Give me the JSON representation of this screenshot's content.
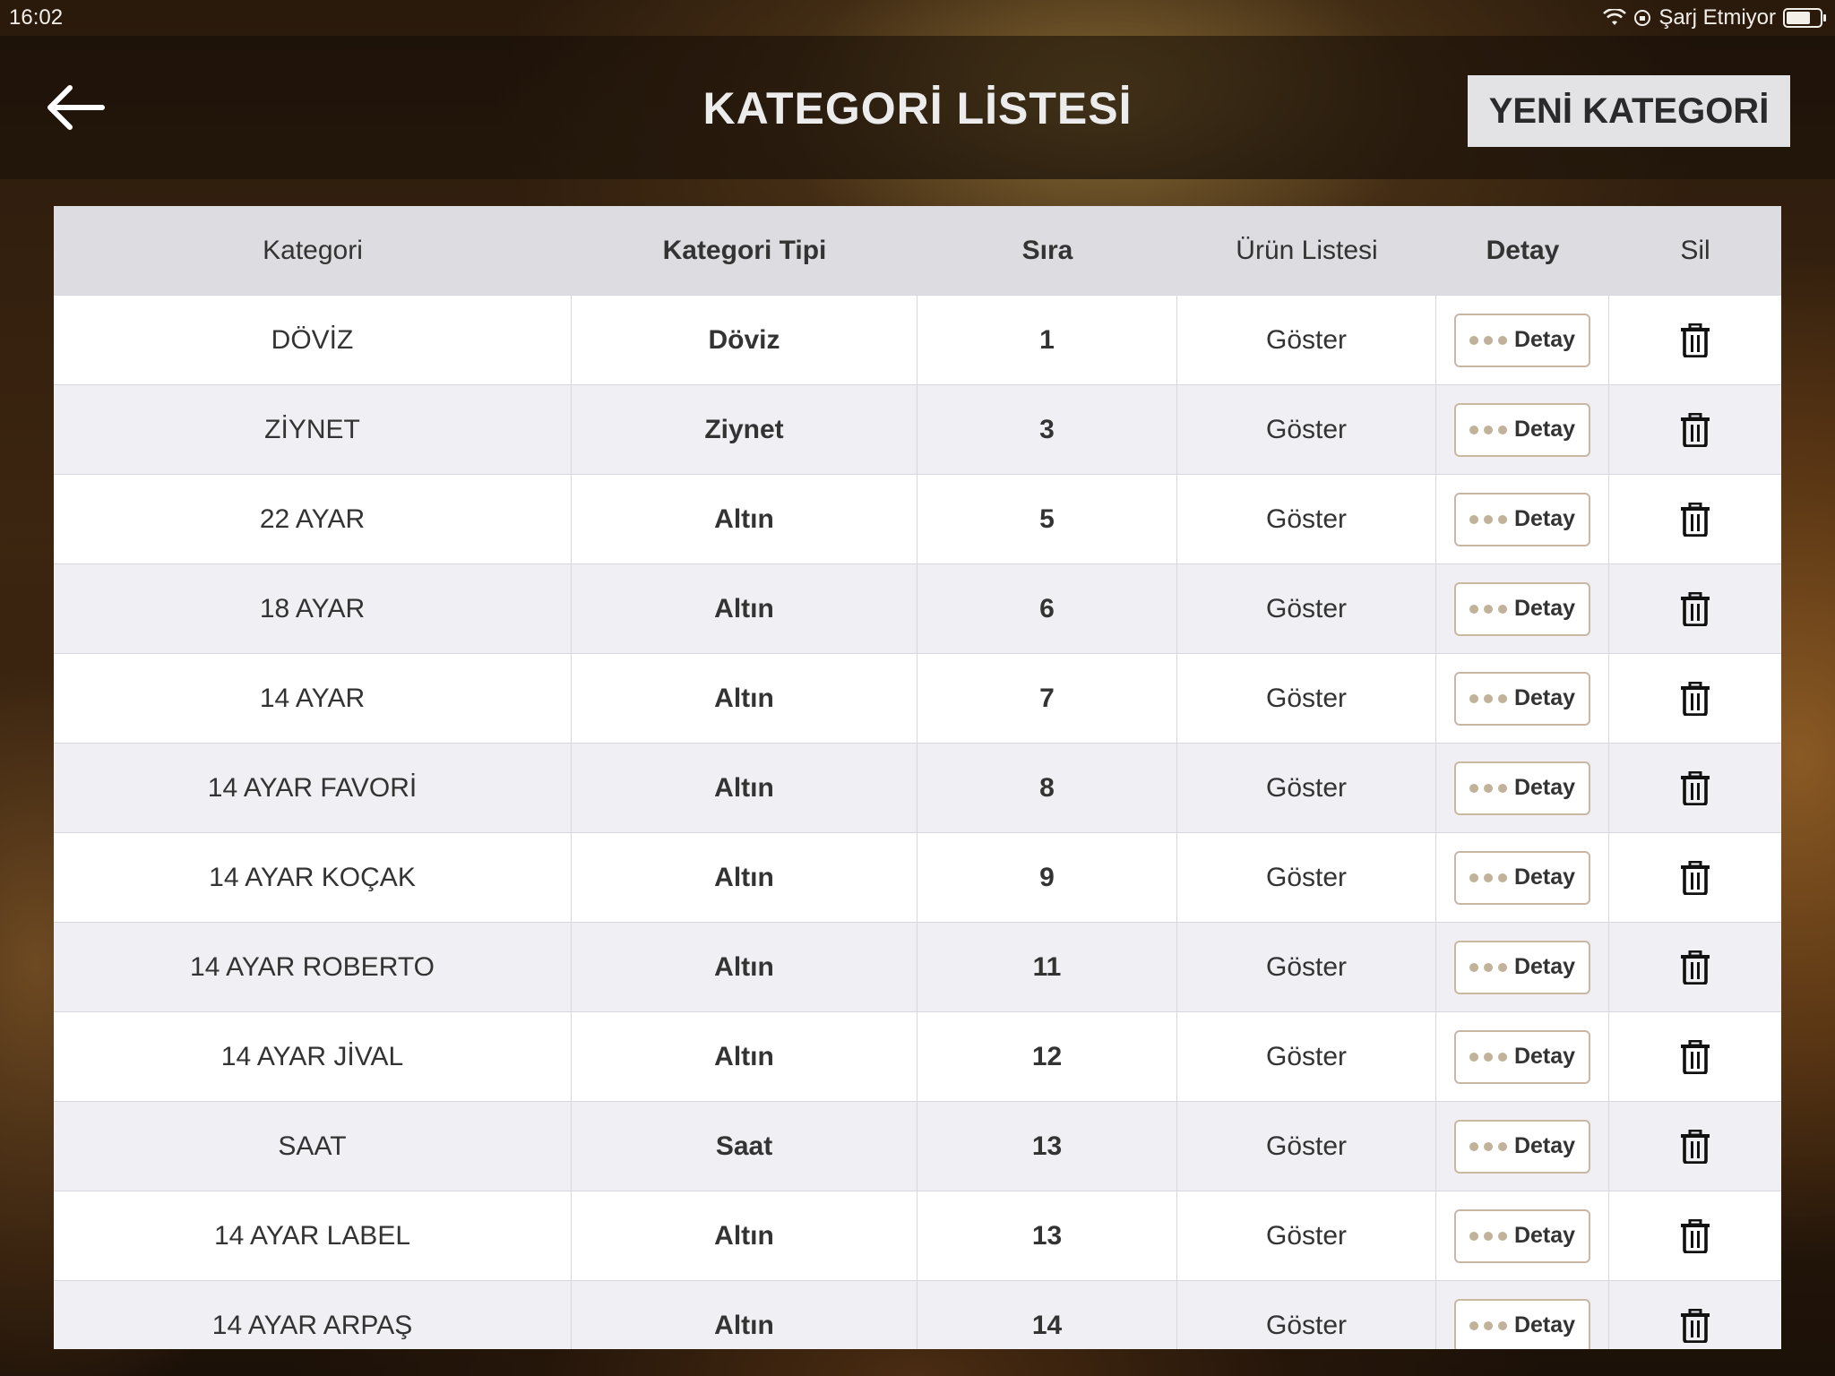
{
  "status_bar": {
    "time": "16:02",
    "charging_text": "Şarj Etmiyor"
  },
  "header": {
    "title": "KATEGORİ LİSTESİ",
    "new_button": "YENİ KATEGORİ",
    "back_icon": "arrow-left-icon"
  },
  "table": {
    "columns": [
      "Kategori",
      "Kategori Tipi",
      "Sıra",
      "Ürün Listesi",
      "Detay",
      "Sil"
    ],
    "rows": [
      {
        "kategori": "DÖVİZ",
        "tip": "Döviz",
        "sira": "1",
        "urun": "Göster",
        "detay": "Detay"
      },
      {
        "kategori": "ZİYNET",
        "tip": "Ziynet",
        "sira": "3",
        "urun": "Göster",
        "detay": "Detay"
      },
      {
        "kategori": "22 AYAR",
        "tip": "Altın",
        "sira": "5",
        "urun": "Göster",
        "detay": "Detay"
      },
      {
        "kategori": "18 AYAR",
        "tip": "Altın",
        "sira": "6",
        "urun": "Göster",
        "detay": "Detay"
      },
      {
        "kategori": "14 AYAR",
        "tip": "Altın",
        "sira": "7",
        "urun": "Göster",
        "detay": "Detay"
      },
      {
        "kategori": "14 AYAR FAVORİ",
        "tip": "Altın",
        "sira": "8",
        "urun": "Göster",
        "detay": "Detay"
      },
      {
        "kategori": "14 AYAR KOÇAK",
        "tip": "Altın",
        "sira": "9",
        "urun": "Göster",
        "detay": "Detay"
      },
      {
        "kategori": "14 AYAR ROBERTO",
        "tip": "Altın",
        "sira": "11",
        "urun": "Göster",
        "detay": "Detay"
      },
      {
        "kategori": "14 AYAR JİVAL",
        "tip": "Altın",
        "sira": "12",
        "urun": "Göster",
        "detay": "Detay"
      },
      {
        "kategori": "SAAT",
        "tip": "Saat",
        "sira": "13",
        "urun": "Göster",
        "detay": "Detay"
      },
      {
        "kategori": "14 AYAR LABEL",
        "tip": "Altın",
        "sira": "13",
        "urun": "Göster",
        "detay": "Detay"
      },
      {
        "kategori": "14 AYAR ARPAŞ",
        "tip": "Altın",
        "sira": "14",
        "urun": "Göster",
        "detay": "Detay"
      }
    ]
  },
  "colors": {
    "header_bg": "#dcdce1",
    "row_alt": "#efeff4",
    "detay_border": "#c8b8a2",
    "dots": "#c1b09a"
  }
}
